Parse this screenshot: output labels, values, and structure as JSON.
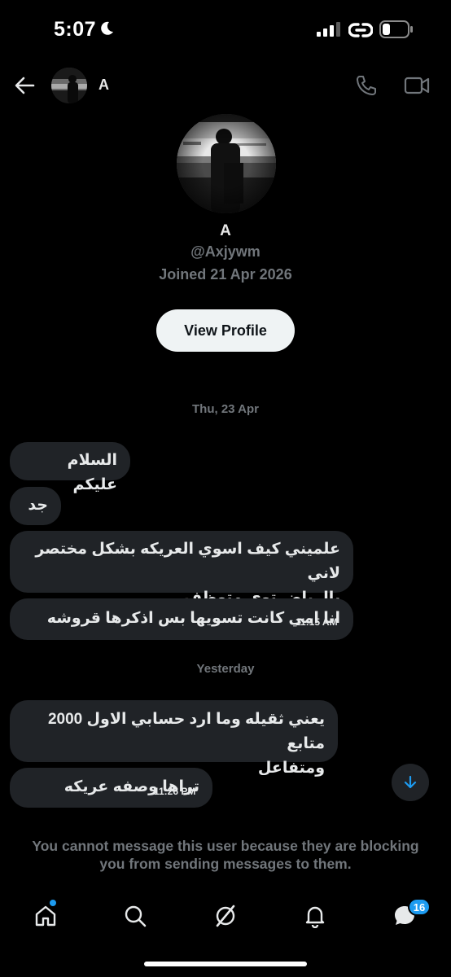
{
  "status_bar": {
    "time": "5:07"
  },
  "header": {
    "name": "A"
  },
  "profile": {
    "name": "A",
    "handle": "@Axjywm",
    "joined": "Joined 21 Apr 2026",
    "view_profile_label": "View Profile"
  },
  "conversation": {
    "date_separator_1": "Thu, 23 Apr",
    "date_separator_2": "Yesterday",
    "messages": [
      {
        "text": "السلام عليكم"
      },
      {
        "text": "جد"
      },
      {
        "line1": "علميني كيف اسوي العريكه بشكل مختصر لاني",
        "line2": "بالرياض توي متوظف"
      },
      {
        "text": "انا امي كانت تسويها بس اذكرها قروشه",
        "time": "11:15 AM"
      },
      {
        "line1": "يعني ثقيله وما ارد حسابي الاول 2000 متابع",
        "line2": "ومتفاعل"
      },
      {
        "text": "تراها وصفه عريكه",
        "time": "11:26 PM"
      }
    ]
  },
  "blocked_notice": {
    "line1": "You cannot message this user because they are blocking",
    "line2": "you from sending messages to them."
  },
  "bottom_nav": {
    "messages_badge": "16",
    "icons": [
      "home-icon",
      "search-icon",
      "grok-icon",
      "notifications-icon",
      "messages-icon"
    ]
  },
  "colors": {
    "accent": "#1d9bf0",
    "bubble": "#202327",
    "muted": "#71767b",
    "button_bg": "#eff3f4"
  }
}
